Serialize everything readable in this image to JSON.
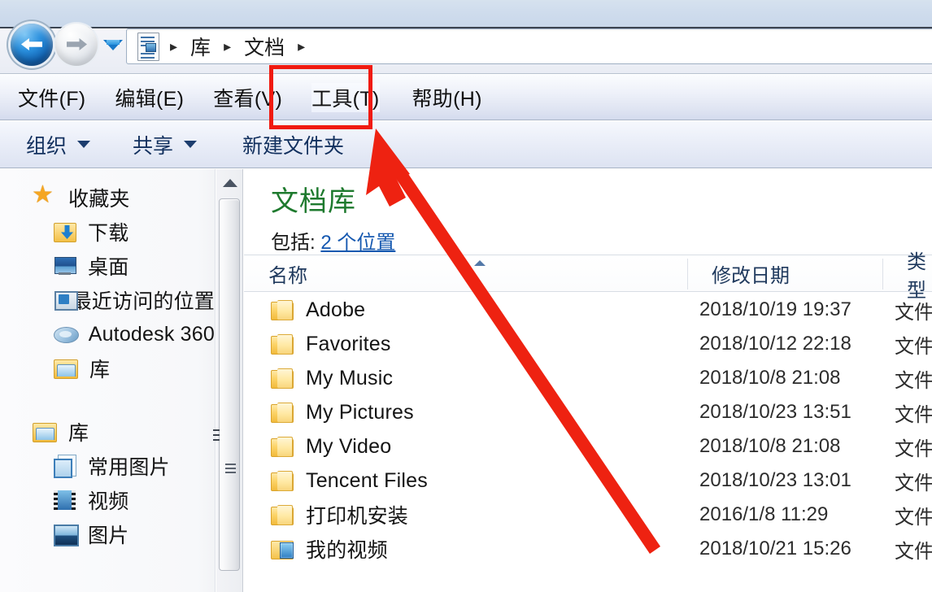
{
  "window": {
    "nav": {
      "back_label": "后退",
      "forward_label": "前进",
      "history_label": "最近浏览的位置"
    },
    "address": {
      "icon": "document-library-icon",
      "crumbs": [
        "库",
        "文档"
      ],
      "separator": "▸"
    },
    "menubar": {
      "items": [
        {
          "label": "文件(F)",
          "highlighted": false
        },
        {
          "label": "编辑(E)",
          "highlighted": false
        },
        {
          "label": "查看(V)",
          "highlighted": false
        },
        {
          "label": "工具(T)",
          "highlighted": true
        },
        {
          "label": "帮助(H)",
          "highlighted": false
        }
      ]
    },
    "toolbar": {
      "items": [
        {
          "label": "组织",
          "caret": true
        },
        {
          "label": "共享",
          "caret": true
        },
        {
          "label": "新建文件夹",
          "caret": false
        }
      ]
    }
  },
  "annotation": {
    "highlight_color": "#f01a10",
    "highlight_target": "工具(T)",
    "arrow_color": "#ee2211"
  },
  "navpane": {
    "groups": [
      {
        "header": {
          "label": "收藏夹",
          "icon": "star-icon"
        },
        "items": [
          {
            "label": "下载",
            "icon": "downloads-folder-icon"
          },
          {
            "label": "桌面",
            "icon": "desktop-icon"
          },
          {
            "label": "最近访问的位置",
            "icon": "recent-places-icon"
          },
          {
            "label": "Autodesk 360",
            "icon": "autodesk-cloud-icon"
          },
          {
            "label": "库",
            "icon": "library-folder-icon"
          }
        ]
      },
      {
        "header": {
          "label": "库",
          "icon": "library-folder-icon"
        },
        "items": [
          {
            "label": "常用图片",
            "icon": "pictures-doc-icon"
          },
          {
            "label": "视频",
            "icon": "film-icon"
          },
          {
            "label": "图片",
            "icon": "photo-icon"
          }
        ]
      }
    ]
  },
  "library": {
    "title": "文档库",
    "includes_prefix": "包括:",
    "includes_link": "2 个位置"
  },
  "filelist": {
    "columns": [
      {
        "label": "名称",
        "sorted": true,
        "sort_dir": "asc"
      },
      {
        "label": "修改日期",
        "sorted": false
      },
      {
        "label": "类型",
        "sorted": false
      }
    ],
    "rows": [
      {
        "name": "Adobe",
        "icon": "folder-icon",
        "date": "2018/10/19 19:37",
        "type": "文件"
      },
      {
        "name": "Favorites",
        "icon": "folder-icon",
        "date": "2018/10/12 22:18",
        "type": "文件"
      },
      {
        "name": "My Music",
        "icon": "folder-icon",
        "date": "2018/10/8 21:08",
        "type": "文件"
      },
      {
        "name": "My Pictures",
        "icon": "folder-icon",
        "date": "2018/10/23 13:51",
        "type": "文件"
      },
      {
        "name": "My Video",
        "icon": "folder-icon",
        "date": "2018/10/8 21:08",
        "type": "文件"
      },
      {
        "name": "Tencent Files",
        "icon": "folder-icon",
        "date": "2018/10/23 13:01",
        "type": "文件"
      },
      {
        "name": "打印机安装",
        "icon": "folder-icon",
        "date": "2016/1/8 11:29",
        "type": "文件"
      },
      {
        "name": "我的视频",
        "icon": "folder-video-icon",
        "date": "2018/10/21 15:26",
        "type": "文件"
      }
    ]
  }
}
